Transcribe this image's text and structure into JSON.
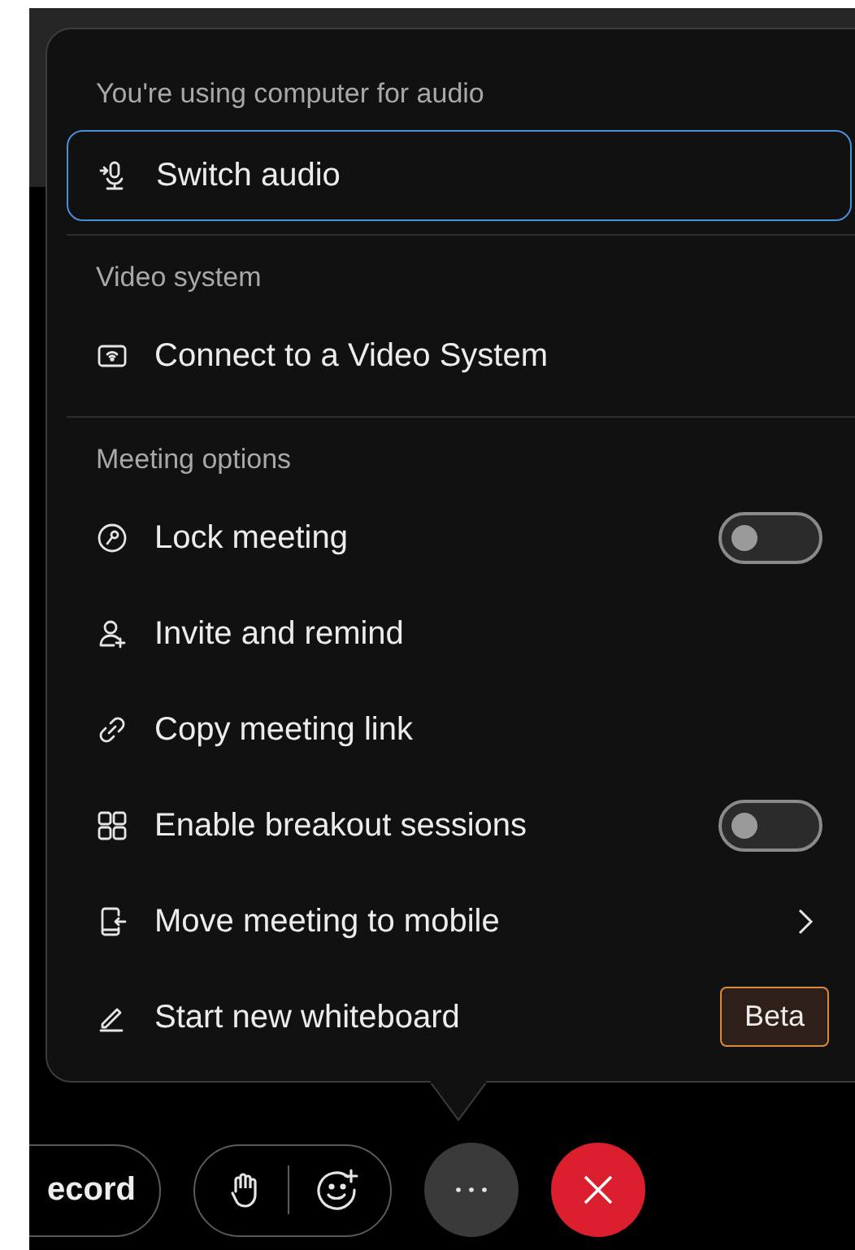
{
  "menu": {
    "sections": [
      {
        "header": "You're using computer for audio",
        "items": [
          {
            "kind": "focused",
            "label": "Switch audio"
          }
        ]
      },
      {
        "header": "Video system",
        "items": [
          {
            "kind": "item",
            "label": "Connect to a Video System"
          }
        ]
      },
      {
        "header": "Meeting options",
        "items": [
          {
            "kind": "toggle",
            "label": "Lock meeting",
            "on": false
          },
          {
            "kind": "item",
            "label": "Invite and remind"
          },
          {
            "kind": "item",
            "label": "Copy meeting link"
          },
          {
            "kind": "toggle",
            "label": "Enable breakout sessions",
            "on": false
          },
          {
            "kind": "submenu",
            "label": "Move meeting to mobile"
          },
          {
            "kind": "badge",
            "label": "Start new whiteboard",
            "badge": "Beta"
          }
        ]
      }
    ]
  },
  "toolbar": {
    "record_label": "ecord"
  }
}
